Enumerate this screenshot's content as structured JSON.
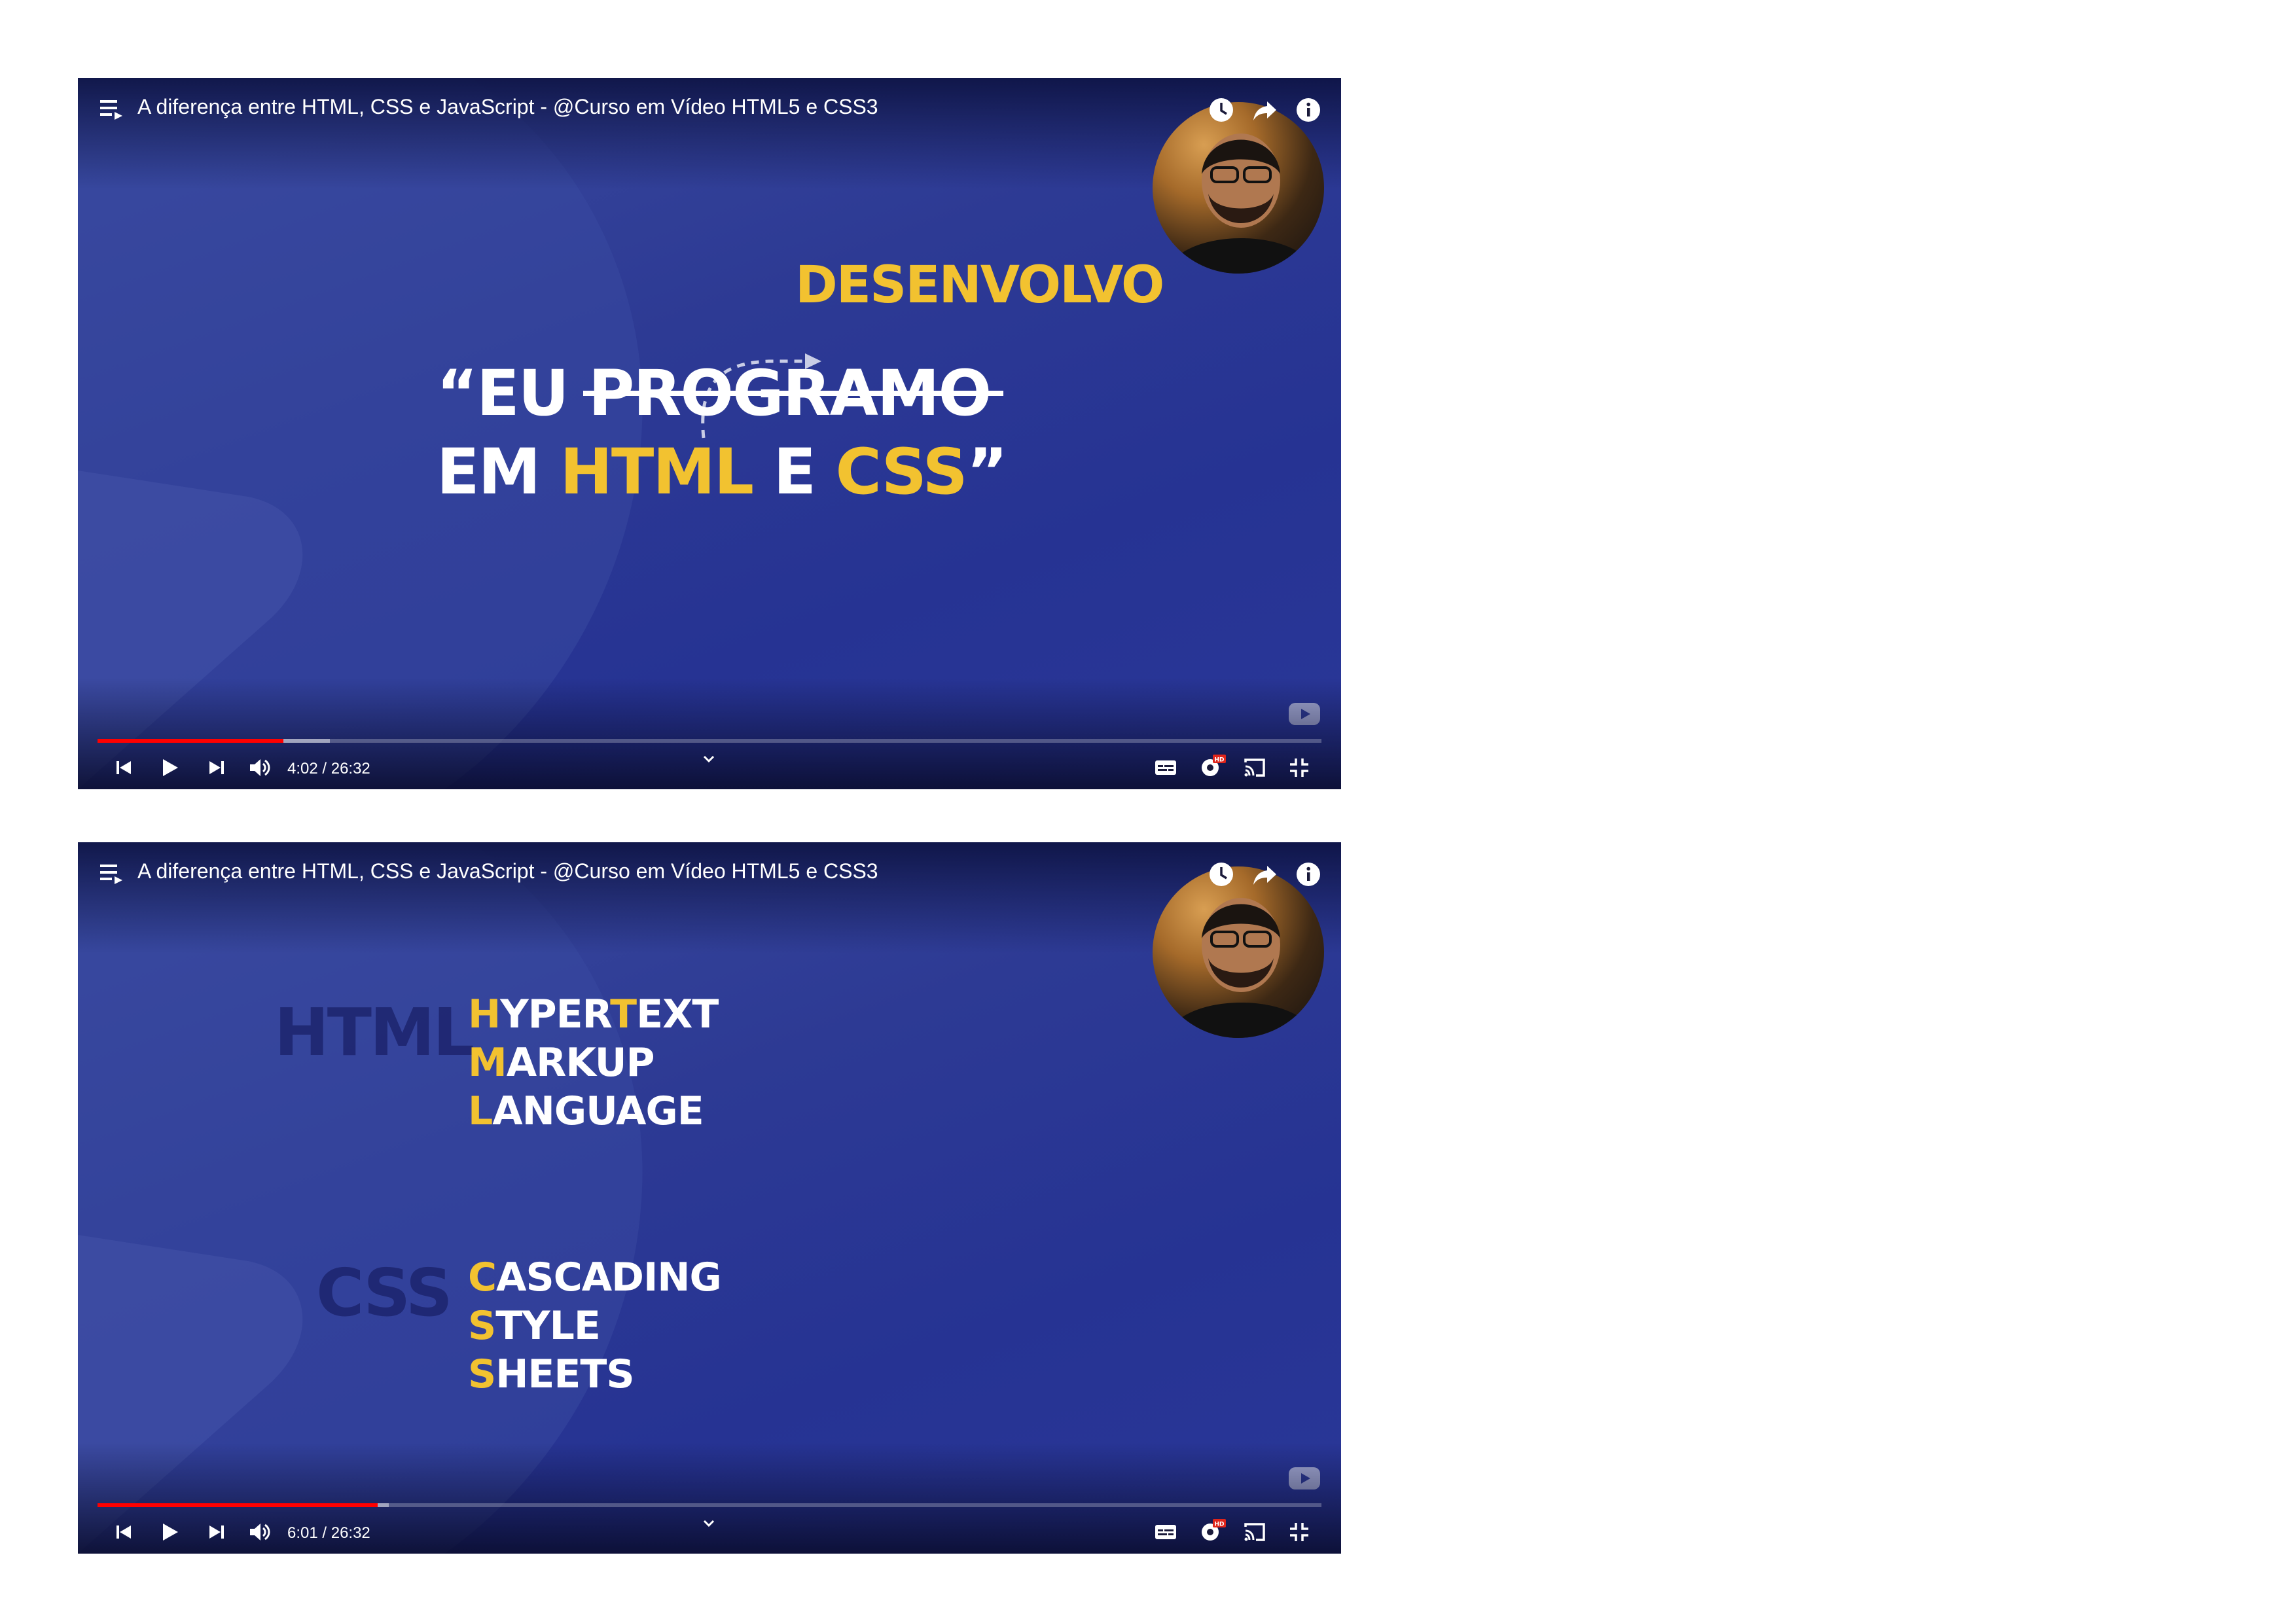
{
  "players": [
    {
      "title": "A diferença entre HTML, CSS e JavaScript - @Curso em Vídeo HTML5 e CSS3",
      "time": "4:02 / 26:32",
      "progress": {
        "played_fraction": 0.152,
        "buffered_fraction": 0.19
      },
      "slide": {
        "line1_quote": "“EU ",
        "line1_struck": "PROGRAMO",
        "replacement": "DESENVOLVO",
        "line2_em": "EM ",
        "line2_html": "HTML",
        "line2_e": " E ",
        "line2_css": "CSS",
        "line2_close": "”"
      }
    },
    {
      "title": "A diferença entre HTML, CSS e JavaScript - @Curso em Vídeo HTML5 e CSS3",
      "time": "6:01 / 26:32",
      "progress": {
        "played_fraction": 0.229,
        "buffered_fraction": 0.238
      },
      "slide": {
        "html_label": "HTML",
        "html_words": [
          {
            "first": "H",
            "rest_a": "YPER",
            "mid": "T",
            "rest_b": "EXT"
          },
          {
            "first": "M",
            "rest": "ARKUP"
          },
          {
            "first": "L",
            "rest": "ANGUAGE"
          }
        ],
        "css_label": "CSS",
        "css_words": [
          {
            "first": "C",
            "rest": "ASCADING"
          },
          {
            "first": "S",
            "rest": "TYLE"
          },
          {
            "first": "S",
            "rest": "HEETS"
          }
        ]
      }
    }
  ],
  "icons": {
    "playlist": "playlist-icon",
    "watch_later": "clock-icon",
    "share": "share-icon",
    "info": "info-icon",
    "prev": "skip-previous-icon",
    "play": "play-icon",
    "next": "skip-next-icon",
    "volume": "volume-icon",
    "chevron": "chevron-down-icon",
    "subtitles": "subtitles-icon",
    "settings": "settings-hd-icon",
    "cast": "cast-icon",
    "exit_fullscreen": "exit-fullscreen-icon",
    "youtube_watermark": "youtube-logo-icon"
  },
  "colors": {
    "accent_yellow": "#f2c230",
    "progress_red": "#ff0000",
    "slide_blue": "#2d3a94",
    "dim_label": "#1e2670"
  },
  "settings_badge": "HD"
}
